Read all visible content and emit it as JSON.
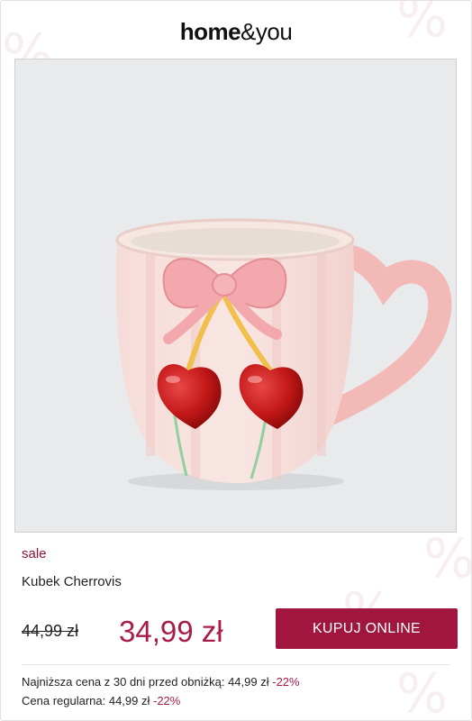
{
  "brand": {
    "logo_bold": "home",
    "logo_light": "&you"
  },
  "product": {
    "image_alt": "Kubek Cherrovis",
    "badge": "sale",
    "name": "Kubek Cherrovis",
    "old_price": "44,99 zł",
    "price": "34,99 zł",
    "buy_label": "KUPUJ ONLINE"
  },
  "price_info": {
    "lowest_label": "Najniższa cena z 30 dni przed obniżką: 44,99 zł",
    "lowest_discount": "-22%",
    "regular_label": "Cena regularna: 44,99 zł",
    "regular_discount": "-22%"
  },
  "colors": {
    "accent": "#a0163f",
    "price": "#a81c4c",
    "image_background": "#e8eaeb"
  }
}
